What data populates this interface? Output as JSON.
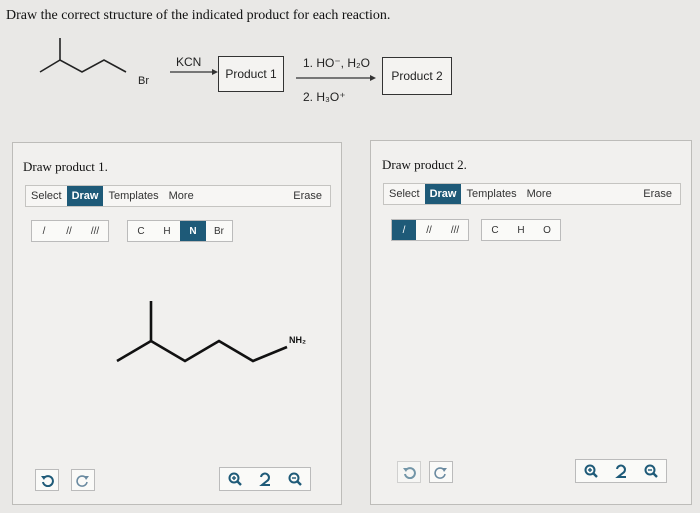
{
  "question": "Draw the correct structure of the indicated product for each reaction.",
  "scheme": {
    "substituent": "Br",
    "reagent1": "KCN",
    "product1": "Product 1",
    "step1": "1. HO⁻, H₂O",
    "step2": "2. H₃O⁺",
    "product2": "Product 2"
  },
  "panel1": {
    "title": "Draw product 1.",
    "toolbar": {
      "select": "Select",
      "draw": "Draw",
      "templates": "Templates",
      "more": "More",
      "erase": "Erase"
    },
    "bonds": [
      "/",
      "//",
      "///"
    ],
    "atoms": [
      "C",
      "H",
      "N",
      "Br"
    ],
    "selected_atom": "N",
    "drawn_label": "NH₂"
  },
  "panel2": {
    "title": "Draw product 2.",
    "toolbar": {
      "select": "Select",
      "draw": "Draw",
      "templates": "Templates",
      "more": "More",
      "erase": "Erase"
    },
    "bonds": [
      "/",
      "//",
      "///"
    ],
    "atoms": [
      "C",
      "H",
      "O"
    ]
  },
  "colors": {
    "accent": "#1e5a78",
    "panel_bg": "#f1f0ee",
    "page_bg": "#e9e8e6"
  }
}
